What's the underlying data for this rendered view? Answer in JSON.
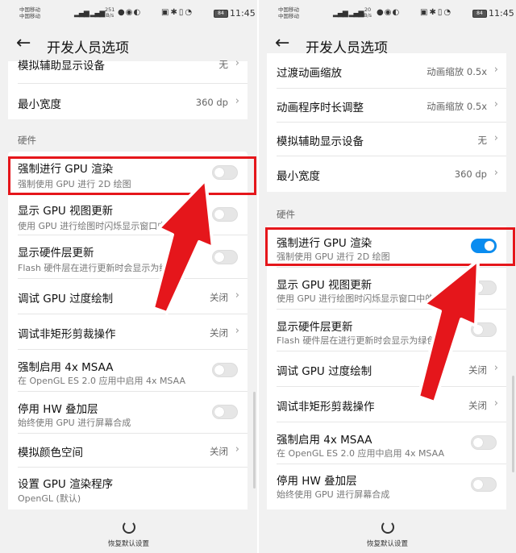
{
  "status": {
    "carrier1": "中国移动",
    "carrier2": "中国移动",
    "network": "4G",
    "time": "11:45",
    "battery": "84",
    "left_speed": "251",
    "right_speed": "20",
    "speed_unit": "B/s"
  },
  "header": {
    "back_icon": "arrow-left-icon",
    "title": "开发人员选项"
  },
  "left": {
    "partial_item": {
      "label": "模拟辅助显示设备",
      "value": "无"
    },
    "min_width": {
      "label": "最小宽度",
      "value": "360 dp"
    },
    "section_hardware": "硬件",
    "items": [
      {
        "label": "强制进行 GPU 渲染",
        "sub": "强制使用 GPU 进行 2D 绘图",
        "toggle": false
      },
      {
        "label": "显示 GPU 视图更新",
        "sub": "使用 GPU 进行绘图时闪烁显示窗口中的视图",
        "toggle": false
      },
      {
        "label": "显示硬件层更新",
        "sub": "Flash 硬件层在进行更新时会显示为绿色",
        "toggle": false
      },
      {
        "label": "调试 GPU 过度绘制",
        "value": "关闭"
      },
      {
        "label": "调试非矩形剪裁操作",
        "value": "关闭"
      },
      {
        "label": "强制启用 4x MSAA",
        "sub": "在 OpenGL ES 2.0 应用中启用 4x MSAA",
        "toggle": false
      },
      {
        "label": "停用 HW 叠加层",
        "sub": "始终使用 GPU 进行屏幕合成",
        "toggle": false
      },
      {
        "label": "模拟颜色空间",
        "value": "关闭"
      },
      {
        "label": "设置 GPU 渲染程序",
        "sub": "OpenGL (默认)"
      }
    ]
  },
  "right": {
    "items_top": [
      {
        "label": "过渡动画缩放",
        "value": "动画缩放 0.5x"
      },
      {
        "label": "动画程序时长调整",
        "value": "动画缩放 0.5x"
      },
      {
        "label": "模拟辅助显示设备",
        "value": "无"
      },
      {
        "label": "最小宽度",
        "value": "360 dp"
      }
    ],
    "section_hardware": "硬件",
    "items": [
      {
        "label": "强制进行 GPU 渲染",
        "sub": "强制使用 GPU 进行 2D 绘图",
        "toggle": true
      },
      {
        "label": "显示 GPU 视图更新",
        "sub": "使用 GPU 进行绘图时闪烁显示窗口中的视图",
        "toggle": false
      },
      {
        "label": "显示硬件层更新",
        "sub": "Flash 硬件层在进行更新时会显示为绿色",
        "toggle": false
      },
      {
        "label": "调试 GPU 过度绘制",
        "value": "关闭"
      },
      {
        "label": "调试非矩形剪裁操作",
        "value": "关闭"
      },
      {
        "label": "强制启用 4x MSAA",
        "sub": "在 OpenGL ES 2.0 应用中启用 4x MSAA",
        "toggle": false
      },
      {
        "label": "停用 HW 叠加层",
        "sub": "始终使用 GPU 进行屏幕合成",
        "toggle": false
      }
    ]
  },
  "footer": {
    "reset_label": "恢复默认设置",
    "reset_icon": "refresh-icon"
  },
  "colors": {
    "highlight": "#e5161b",
    "toggle_on": "#0a8cf0",
    "background": "#f1f1f1"
  }
}
